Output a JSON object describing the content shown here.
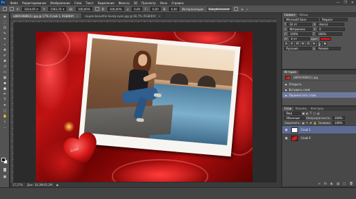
{
  "app": {
    "logo": "Ps"
  },
  "menu": [
    "Файл",
    "Редактирование",
    "Изображение",
    "Слои",
    "Текст",
    "Выделение",
    "Фильтр",
    "3D",
    "Просмотр",
    "Окно",
    "Справка"
  ],
  "window_controls": {
    "minimize": "—",
    "restore": "❐",
    "close": "✕"
  },
  "options_bar": {
    "x_value": "1024,05 п",
    "y_value": "1583,35 п",
    "w_value": "100,00%",
    "h_value": "100,00%",
    "angle_value": "0,00",
    "h_skew_value": "0,00",
    "v_skew_value": "0,00",
    "interpolation_label": "Интерполяция:",
    "interpolation_value": "Бикубическая"
  },
  "doc_tabs": [
    {
      "title": "a86910886(1).jpg @ 17% (Слой 1, RGB/8#)",
      "active": true
    },
    {
      "title": "couple-beautiful-lovely-eyes.jpg @ 66,7% (RGB/8#)",
      "active": false
    }
  ],
  "status_bar": {
    "zoom": "17,57%",
    "doc_info": "Док: 18,3M/43,2M"
  },
  "canvas": {
    "heart_text": "Love"
  },
  "panels": {
    "character": {
      "tabs": [
        "Символ",
        "Абзац"
      ],
      "font_family": "Microsoft Sans",
      "font_style": "Regular",
      "font_size": "24 пт",
      "leading": "(Авто)",
      "tracking_label": "Метрическ",
      "tracking_value": "0",
      "scale_v": "100%",
      "scale_h": "100%",
      "baseline": "0 пт",
      "color_label": "Цвет:",
      "color_value": "#d11a1a",
      "style_buttons": [
        "T",
        "T",
        "TT",
        "Tт",
        "T¹",
        "T₁",
        "T",
        "T"
      ],
      "language": "Русский",
      "antialias": "Резкое"
    },
    "history": {
      "tabs": [
        "История"
      ],
      "snapshot": "a86910886(1).jpg",
      "items": [
        {
          "label": "Открыть",
          "selected": false
        },
        {
          "label": "Вставить слой",
          "selected": false
        },
        {
          "label": "Переместить слой",
          "selected": true
        }
      ]
    },
    "layers": {
      "tabs": [
        "Слои",
        "Каналы",
        "Контуры"
      ],
      "filter_label": "Вид",
      "blend_mode": "Обычные",
      "opacity_label": "Непрозрачность:",
      "opacity_value": "100%",
      "lock_label": "Закрепить:",
      "fill_label": "Заливка:",
      "fill_value": "100%",
      "layers": [
        {
          "name": "Слой 1",
          "selected": true,
          "thumb": "white"
        },
        {
          "name": "Слой 0",
          "selected": false,
          "thumb": "red"
        }
      ],
      "footer_icons": [
        "∞",
        "fx",
        "◐",
        "▤",
        "▢",
        "🗑"
      ]
    }
  },
  "colors": {
    "accent_selected": "#5b6b94",
    "canvas_red": "#c01212"
  }
}
